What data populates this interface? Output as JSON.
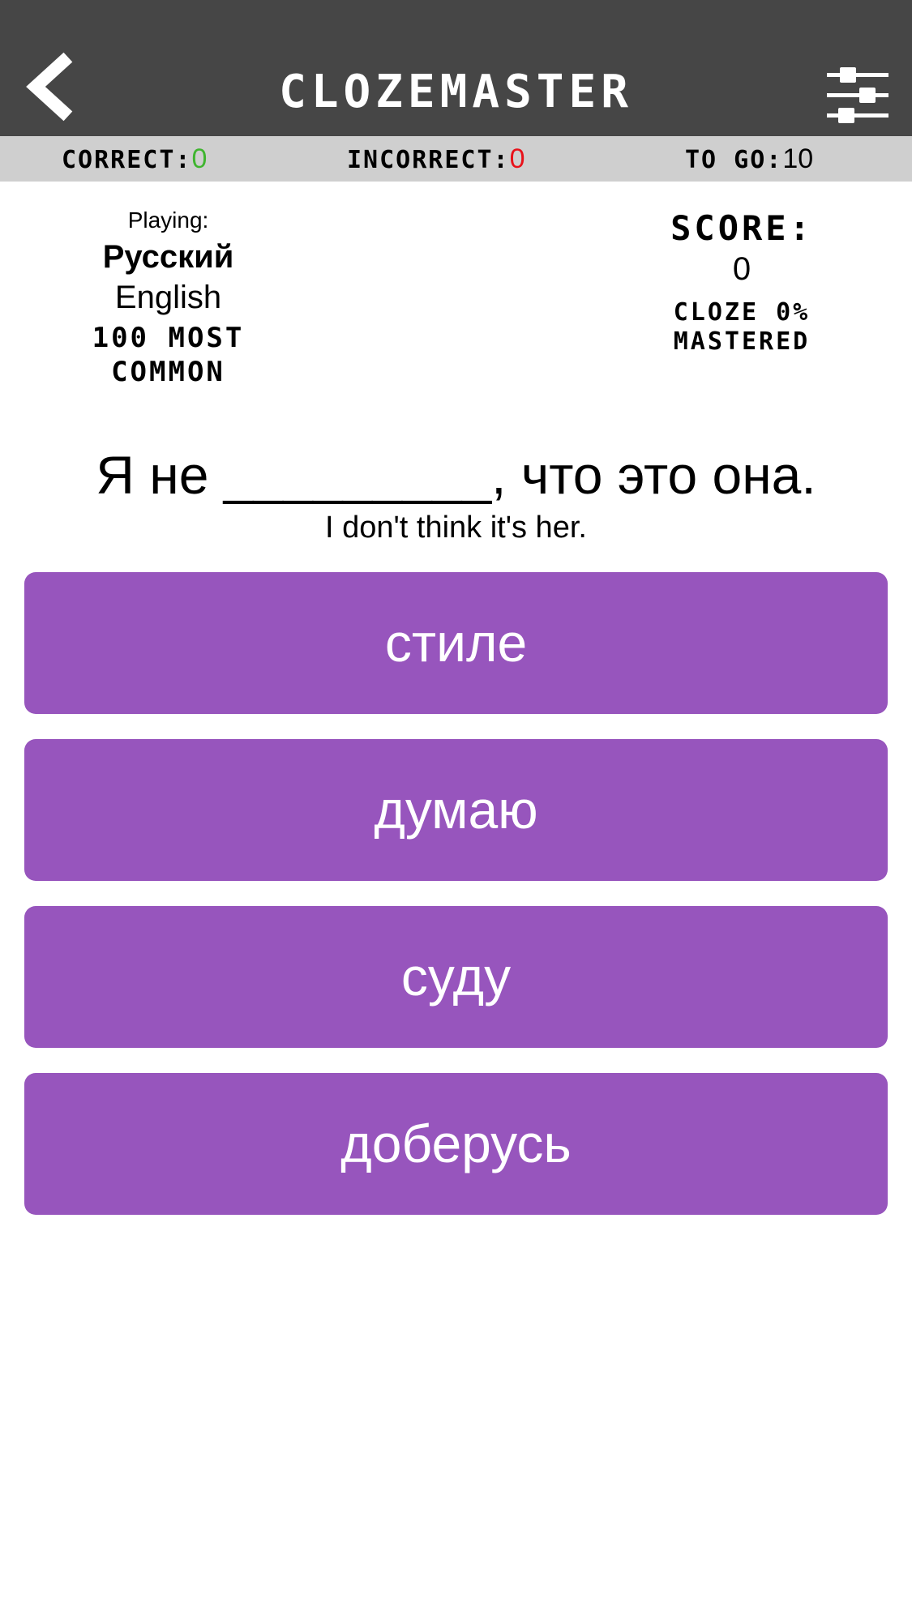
{
  "header": {
    "title": "CLOZEMASTER",
    "back_icon": "chevron-left-icon",
    "settings_icon": "sliders-icon"
  },
  "stats": {
    "correct_label": "CORRECT:",
    "correct_value": "0",
    "incorrect_label": "INCORRECT:",
    "incorrect_value": "0",
    "to_go_label": "TO GO:",
    "to_go_value": "10"
  },
  "info": {
    "playing_label": "Playing:",
    "target_language": "Русский",
    "native_language": "English",
    "collection_line1": "100 MOST",
    "collection_line2": "COMMON",
    "score_label": "SCORE:",
    "score_value": "0",
    "mastered_line1": "CLOZE 0%",
    "mastered_line2": "MASTERED"
  },
  "question": {
    "before_blank": "Я не ",
    "blank": "_________",
    "after_blank": ", что это она.",
    "translation": "I don't think it's her."
  },
  "answers": [
    {
      "label": "стиле"
    },
    {
      "label": "думаю"
    },
    {
      "label": "суду"
    },
    {
      "label": "доберусь"
    }
  ],
  "colors": {
    "header_bg": "#464646",
    "stats_bg": "#cfcfcf",
    "correct": "#3fb52f",
    "incorrect": "#e8121a",
    "answer_bg": "#9755bd"
  }
}
